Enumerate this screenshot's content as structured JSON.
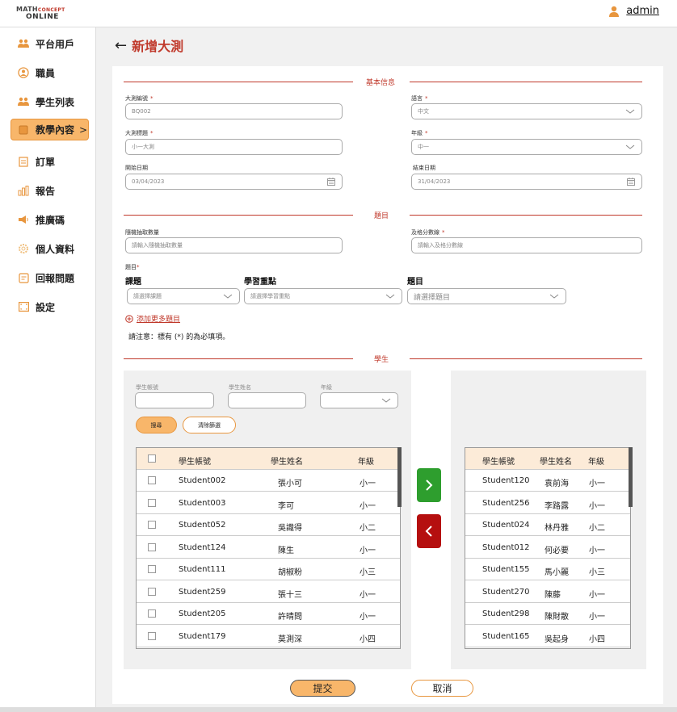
{
  "brand": {
    "line1": "MATH",
    "line1b": "CONCEPT",
    "line2": "ONLINE",
    "accent": "#c0392b",
    "orange": "#f8b66a"
  },
  "user": {
    "name": "admin",
    "icon": "user-icon"
  },
  "sidebar": {
    "items": [
      {
        "label": "平台用戶",
        "icon": "users-icon"
      },
      {
        "label": "職員",
        "icon": "staff-icon"
      },
      {
        "label": "學生列表",
        "icon": "students-icon"
      },
      {
        "label": "教學內容",
        "icon": "book-icon",
        "suffix": ">",
        "active": true
      },
      {
        "label": "訂單",
        "icon": "order-icon"
      },
      {
        "label": "報告",
        "icon": "chart-icon"
      },
      {
        "label": "推廣碼",
        "icon": "megaphone-icon"
      },
      {
        "label": "個人資料",
        "icon": "gear-icon"
      },
      {
        "label": "回報問題",
        "icon": "report-icon"
      },
      {
        "label": "設定",
        "icon": "settings-icon"
      }
    ]
  },
  "page": {
    "back": "←",
    "title": "新增大測"
  },
  "basic": {
    "section_title": "基本信息",
    "test_id_label": "大測編號",
    "test_id_value": "BQ002",
    "language_label": "語言",
    "language_value": "中文",
    "test_title_label": "大測標題",
    "test_title_value": "小一大測",
    "grade_label": "年級",
    "grade_value": "中一",
    "start_label": "開始日期",
    "start_value": "03/04/2023",
    "end_label": "結束日期",
    "end_value": "31/04/2023"
  },
  "questions": {
    "section_title": "題目",
    "random_label": "隨機抽取數量",
    "random_placeholder": "請輸入隨機抽取數量",
    "pass_label": "及格分數線",
    "pass_placeholder": "請輸入及格分數線",
    "q_label": "題目",
    "col_topic": "課題",
    "col_focus": "學習重點",
    "col_question": "題目",
    "topic_placeholder": "請選擇課題",
    "focus_placeholder": "請選擇學習重點",
    "question_placeholder": "請選擇題目",
    "add_more": "添加更多題目",
    "note": "請注意：標有 (*) 的為必填項。"
  },
  "students": {
    "section_title": "學生",
    "filter_id_label": "學生帳號",
    "filter_name_label": "學生姓名",
    "filter_grade_label": "年級",
    "search_btn": "搜尋",
    "clear_btn": "清除篩選",
    "headers": [
      "學生帳號",
      "學生姓名",
      "年級"
    ],
    "left_rows": [
      [
        "Student002",
        "張小可",
        "小一"
      ],
      [
        "Student003",
        "李可",
        "小一"
      ],
      [
        "Student052",
        "吳識得",
        "小二"
      ],
      [
        "Student124",
        "陳生",
        "小一"
      ],
      [
        "Student111",
        "胡椒粉",
        "小三"
      ],
      [
        "Student259",
        "張十三",
        "小一"
      ],
      [
        "Student205",
        "許晴問",
        "小一"
      ],
      [
        "Student179",
        "莫測深",
        "小四"
      ]
    ],
    "right_rows": [
      [
        "Student120",
        "袁前海",
        "小一"
      ],
      [
        "Student256",
        "李路露",
        "小一"
      ],
      [
        "Student024",
        "林丹雅",
        "小二"
      ],
      [
        "Student012",
        "何必要",
        "小一"
      ],
      [
        "Student155",
        "馬小麗",
        "小三"
      ],
      [
        "Student270",
        "陳藤",
        "小一"
      ],
      [
        "Student298",
        "陳財散",
        "小一"
      ],
      [
        "Student165",
        "吳起身",
        "小四"
      ]
    ]
  },
  "actions": {
    "submit": "提交",
    "cancel": "取消"
  }
}
